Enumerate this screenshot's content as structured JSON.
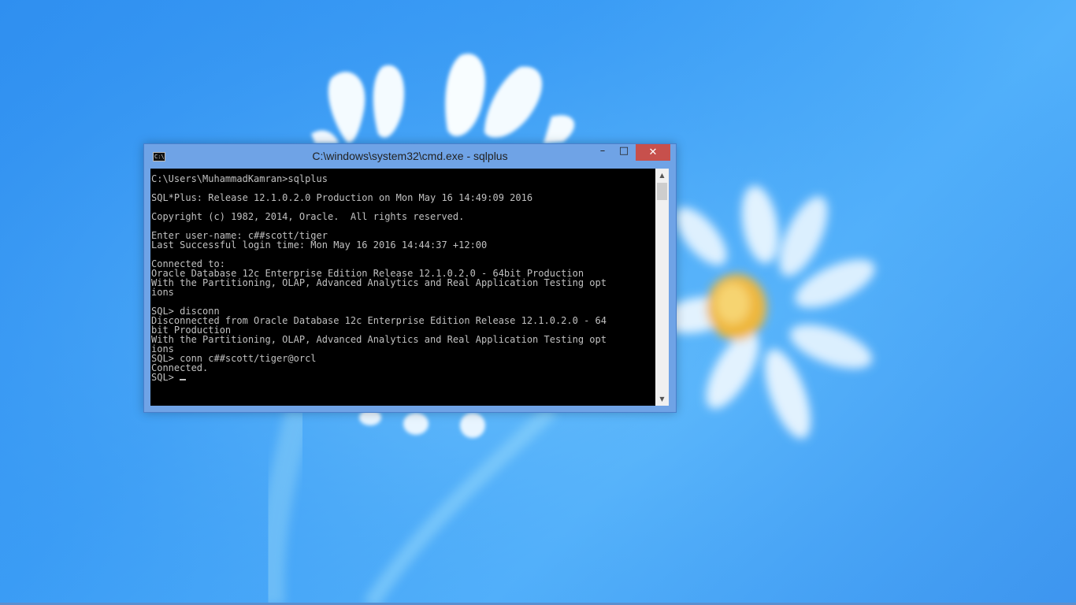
{
  "window": {
    "title": "C:\\windows\\system32\\cmd.exe - sqlplus",
    "icon_name": "cmd-app-icon",
    "icon_text": "C:\\",
    "minimize_icon": "–",
    "maximize_icon": "□",
    "close_icon": "✕"
  },
  "console": {
    "lines": [
      "C:\\Users\\MuhammadKamran>sqlplus",
      "",
      "SQL*Plus: Release 12.1.0.2.0 Production on Mon May 16 14:49:09 2016",
      "",
      "Copyright (c) 1982, 2014, Oracle.  All rights reserved.",
      "",
      "Enter user-name: c##scott/tiger",
      "Last Successful login time: Mon May 16 2016 14:44:37 +12:00",
      "",
      "Connected to:",
      "Oracle Database 12c Enterprise Edition Release 12.1.0.2.0 - 64bit Production",
      "With the Partitioning, OLAP, Advanced Analytics and Real Application Testing opt",
      "ions",
      "",
      "SQL> disconn",
      "Disconnected from Oracle Database 12c Enterprise Edition Release 12.1.0.2.0 - 64",
      "bit Production",
      "With the Partitioning, OLAP, Advanced Analytics and Real Application Testing opt",
      "ions",
      "SQL> conn c##scott/tiger@orcl",
      "Connected."
    ],
    "prompt": "SQL> ",
    "text_color": "#c0c0c0",
    "background_color": "#000000"
  },
  "scrollbar": {
    "up_icon": "▲",
    "down_icon": "▼"
  },
  "colors": {
    "desktop_background": "#3a9cf5",
    "window_frame": "#6fa3e6",
    "close_button": "#c7504c"
  }
}
